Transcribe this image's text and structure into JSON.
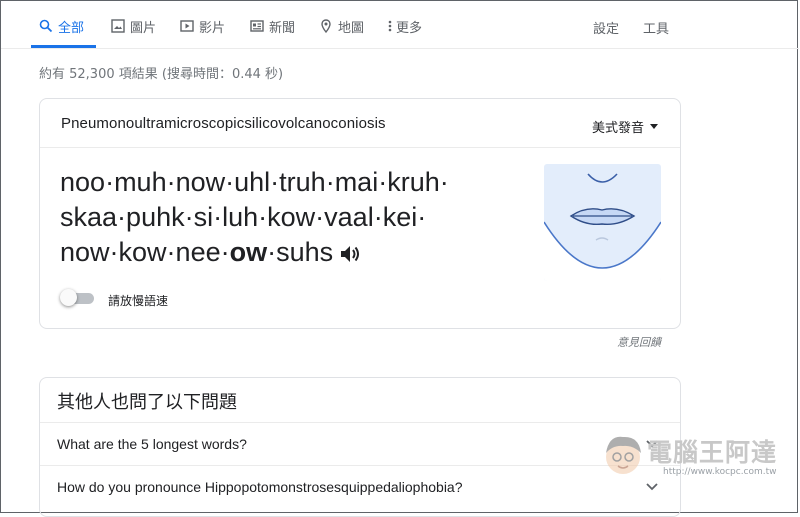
{
  "tabs": [
    {
      "label": "全部",
      "icon": "search-icon",
      "active": true
    },
    {
      "label": "圖片",
      "icon": "image-icon"
    },
    {
      "label": "影片",
      "icon": "video-icon"
    },
    {
      "label": "新聞",
      "icon": "news-icon"
    },
    {
      "label": "地圖",
      "icon": "map-pin-icon"
    },
    {
      "label": "更多",
      "icon": "more-vert-icon"
    }
  ],
  "tools": {
    "settings": "設定",
    "tools": "工具"
  },
  "result_stats": "約有 52,300 項結果 (搜尋時間：0.44 秒)",
  "pronunciation": {
    "word": "Pneumonoultramicroscopicsilicovolcanoconiosis",
    "accent": "美式發音",
    "syllables": [
      "noo",
      "muh",
      "now",
      "uhl",
      "truh",
      "mai",
      "kruh",
      "skaa",
      "puhk",
      "si",
      "luh",
      "kow",
      "vaal",
      "kei",
      "now",
      "kow",
      "nee",
      "ow",
      "suhs"
    ],
    "stressed_index": 17,
    "slow_toggle_label": "請放慢語速",
    "slow_toggle_on": false
  },
  "feedback": "意見回饋",
  "people_also_ask": {
    "title": "其他人也問了以下問題",
    "questions": [
      "What are the 5 longest words?",
      "How do you pronounce Hippopotomonstrosesquippedaliophobia?"
    ]
  },
  "watermark": {
    "text": "電腦王阿達",
    "url": "http://www.kocpc.com.tw"
  },
  "colors": {
    "accent_blue": "#1a73e8",
    "text": "#202124",
    "muted": "#70757a",
    "mouth_bg": "#e3edfb"
  }
}
